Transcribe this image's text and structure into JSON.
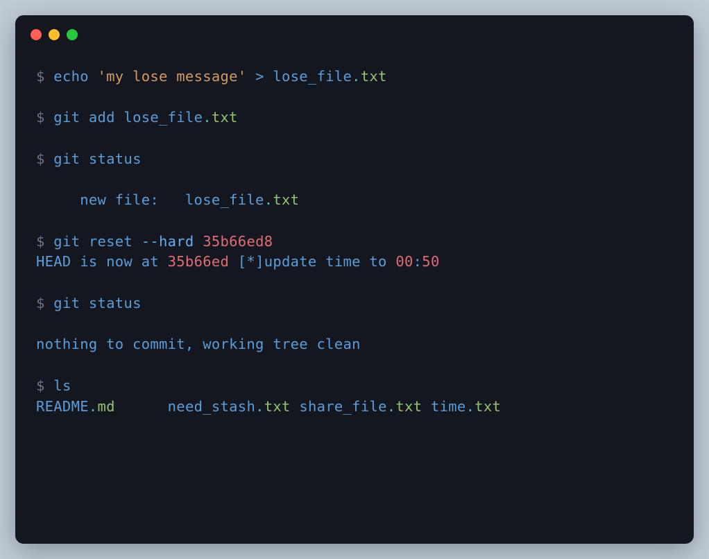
{
  "line1": {
    "prompt": "$",
    "cmd": " echo ",
    "str": "'my lose message'",
    "op": " > lose_file",
    "dot": ".",
    "ext": "txt"
  },
  "line3": {
    "prompt": "$",
    "cmd": " git add lose_file",
    "dot": ".",
    "ext": "txt"
  },
  "line5": {
    "prompt": "$",
    "cmd": " git status"
  },
  "line7": {
    "indent": "     new file:   lose_file",
    "dot": ".",
    "ext": "txt"
  },
  "line9": {
    "prompt": "$",
    "cmd1": " git reset ",
    "flag": "--hard",
    "space": " ",
    "hash": "35b66ed8"
  },
  "line10": {
    "p1": "HEAD is now at ",
    "hash": "35b66ed",
    "p2": " [*]update time to ",
    "t1": "00",
    "colon": ":",
    "t2": "50"
  },
  "line12": {
    "prompt": "$",
    "cmd": " git status"
  },
  "line14": {
    "text": "nothing to commit, working tree clean"
  },
  "line16": {
    "prompt": "$",
    "cmd": " ls"
  },
  "line17": {
    "f1": "README",
    "d1": ".",
    "e1": "md",
    "gap1": "      need_stash",
    "d2": ".",
    "e2": "txt",
    "f3": " share_file",
    "d3": ".",
    "e3": "txt",
    "f4": " time",
    "d4": ".",
    "e4": "txt"
  }
}
